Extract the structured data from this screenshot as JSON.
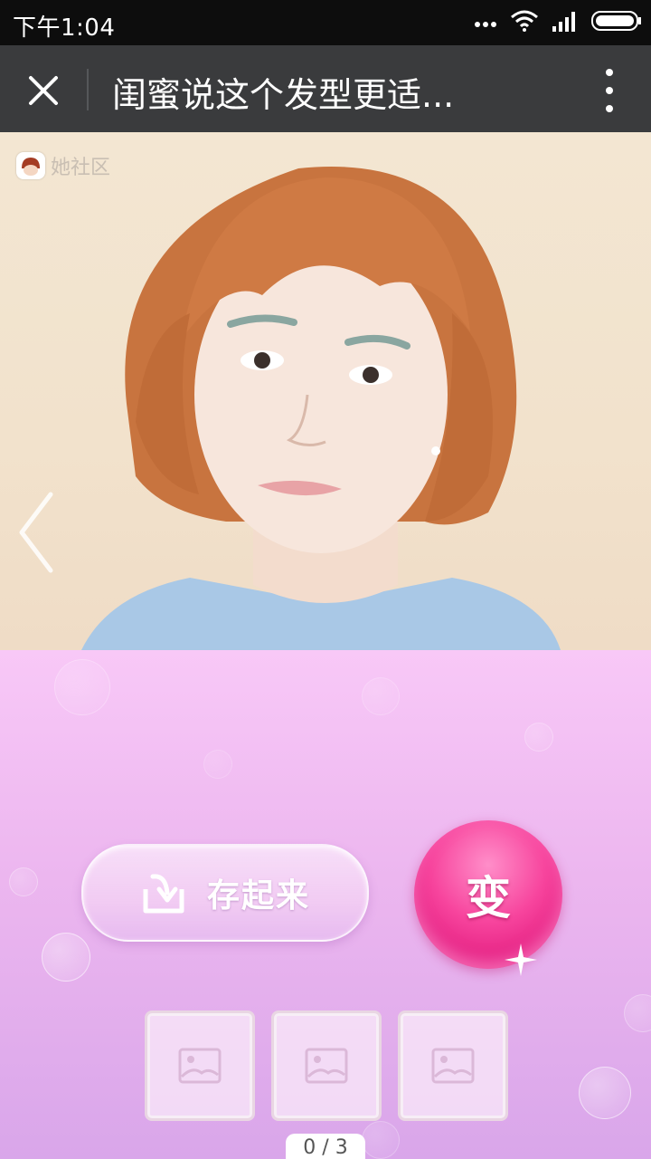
{
  "status_bar": {
    "time": "下午1:04",
    "icons": [
      "more-dots-icon",
      "wifi-icon",
      "signal-icon",
      "battery-icon"
    ]
  },
  "title_bar": {
    "title": "闺蜜说这个发型更适...",
    "close_icon": "close-icon",
    "menu_icon": "more-vertical-icon",
    "background": "#3a3b3d"
  },
  "photo": {
    "watermark_text": "她社区",
    "prev_icon": "chevron-left-icon"
  },
  "actions": {
    "save_label": "存起来",
    "save_icon": "download-tray-icon",
    "transform_label": "变",
    "transform_color": "#f7449d"
  },
  "thumbnails": [
    {
      "icon": "image-placeholder-icon"
    },
    {
      "icon": "image-placeholder-icon"
    },
    {
      "icon": "image-placeholder-icon"
    }
  ],
  "pager": {
    "text": "0 / 3"
  }
}
